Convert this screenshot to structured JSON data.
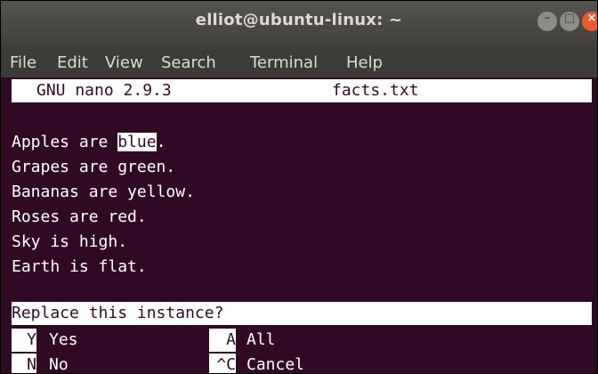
{
  "window": {
    "title": "elliot@ubuntu-linux: ~"
  },
  "menu": [
    "File",
    "Edit",
    "View",
    "Search",
    "Terminal",
    "Help"
  ],
  "nano": {
    "version": "GNU nano 2.9.3",
    "filename": "facts.txt"
  },
  "file_lines": [
    {
      "before": "Apples are ",
      "highlight": "blue",
      "after": "."
    },
    {
      "text": "Grapes are green."
    },
    {
      "text": "Bananas are yellow."
    },
    {
      "text": "Roses are red."
    },
    {
      "text": "Sky is high."
    },
    {
      "text": "Earth is flat."
    }
  ],
  "prompt": "Replace this instance?",
  "options": [
    {
      "key": "Y",
      "label": "Yes"
    },
    {
      "key": "A",
      "label": "All"
    },
    {
      "key": "N",
      "label": "No"
    },
    {
      "key": "^C",
      "label": "Cancel"
    }
  ],
  "colors": {
    "terminal_bg": "#300a24",
    "fg": "#ffffff",
    "close": "#ef5a2a"
  }
}
